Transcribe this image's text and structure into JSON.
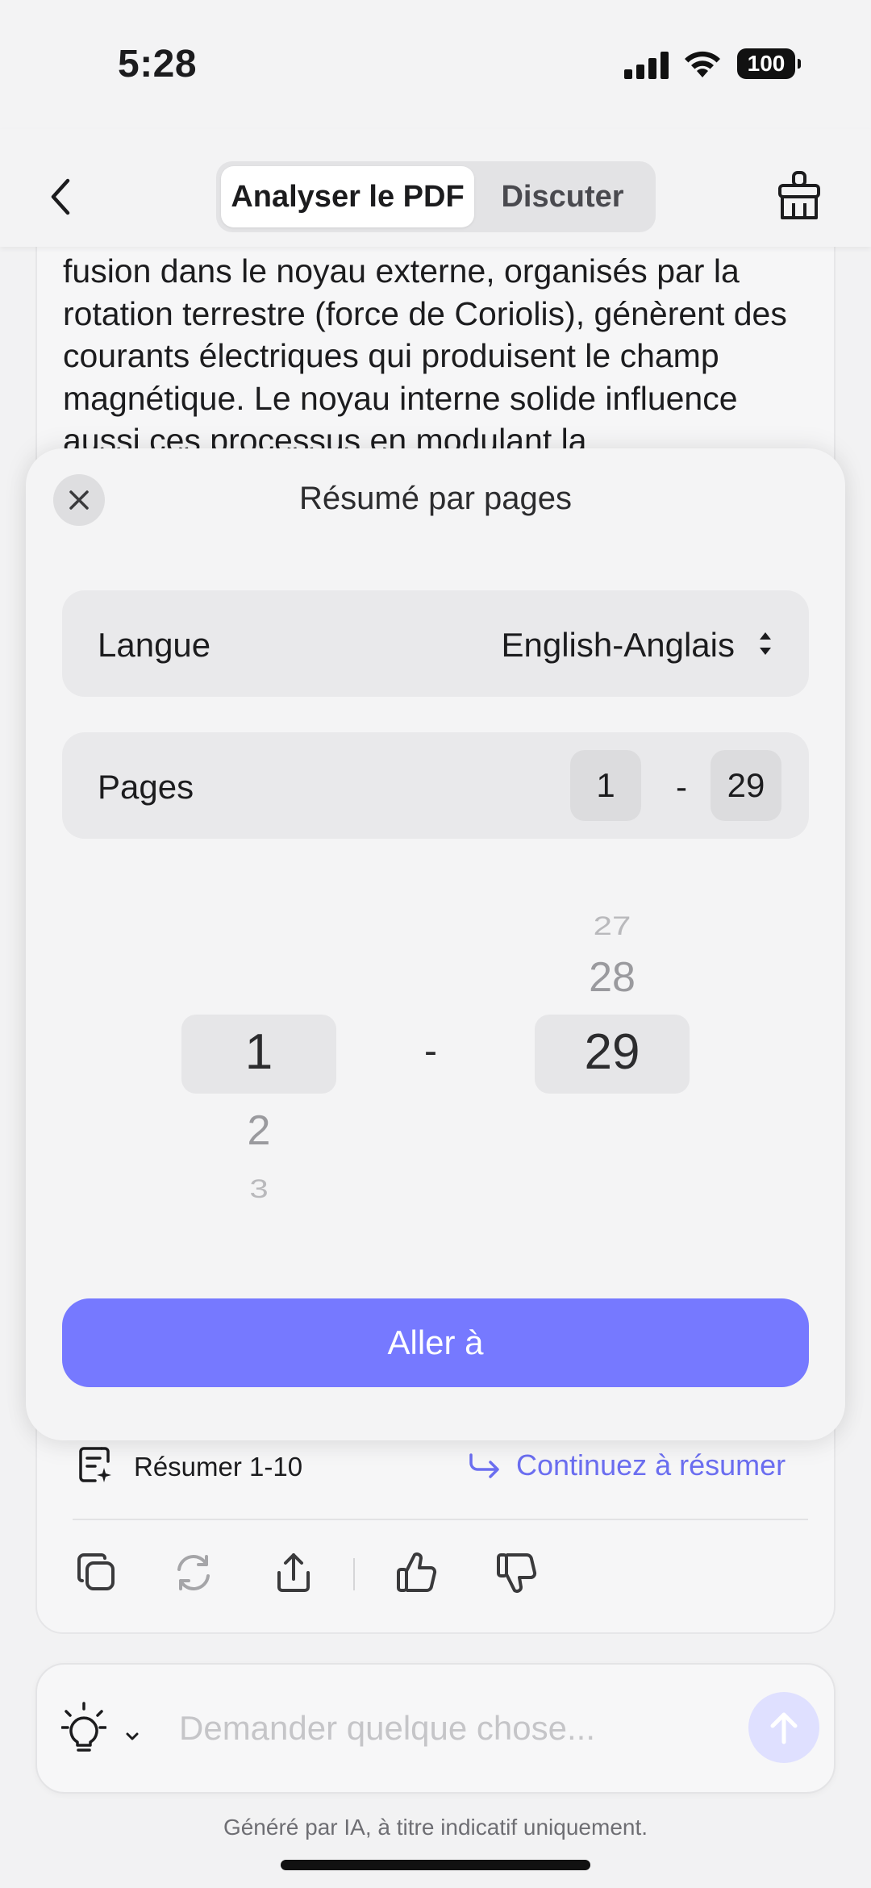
{
  "status_bar": {
    "time": "5:28",
    "battery": "100"
  },
  "header": {
    "tabs": [
      {
        "label": "Analyser le PDF",
        "active": true
      },
      {
        "label": "Discuter",
        "active": false
      }
    ]
  },
  "chat": {
    "body_text": "fusion dans le noyau externe, organisés par la rotation terrestre (force de Coriolis), génèrent des courants électriques qui produisent le champ magnétique. Le noyau interne solide influence aussi ces processus en modulant la",
    "summarize_label": "Résumer 1-10",
    "continue_label": "Continuez à résumer"
  },
  "sheet": {
    "title": "Résumé par pages",
    "language_label": "Langue",
    "language_value": "English-Anglais",
    "pages_label": "Pages",
    "page_from": "1",
    "page_separator": "-",
    "page_to": "29",
    "picker": {
      "left": {
        "selected": "1",
        "below": [
          "2",
          "3"
        ]
      },
      "right": {
        "above": [
          "27",
          "28"
        ],
        "selected": "29"
      },
      "separator": "-"
    },
    "go_button": "Aller à"
  },
  "input": {
    "placeholder": "Demander quelque chose..."
  },
  "disclaimer": "Généré par IA, à titre indicatif uniquement.",
  "colors": {
    "accent": "#7679FF",
    "link": "#6B6EF0",
    "send_bg": "#DFE0FF"
  }
}
